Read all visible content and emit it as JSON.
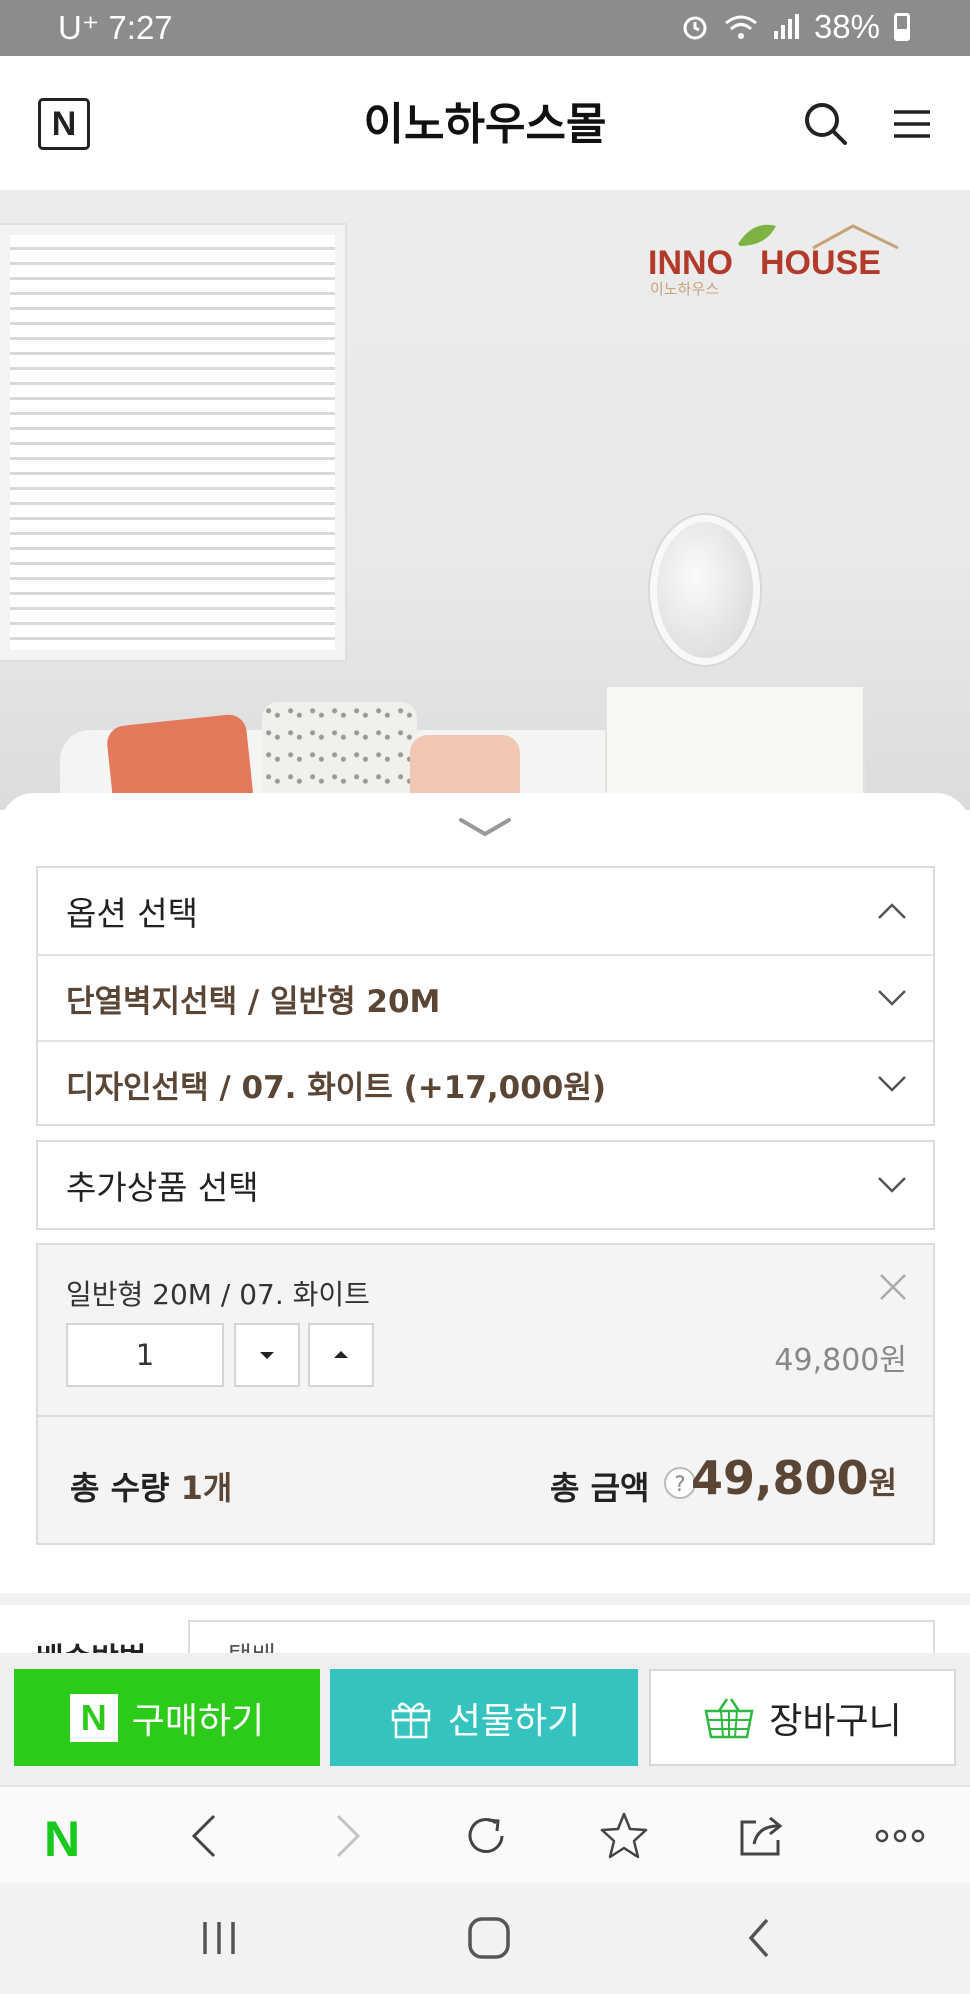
{
  "status_bar": {
    "carrier": "U⁺",
    "time": "7:27",
    "battery": "38%"
  },
  "header": {
    "logo": "N",
    "title": "이노하우스몰"
  },
  "hero": {
    "brand_en_1": "INNO",
    "brand_en_2": "HOUSE",
    "brand_kr": "이노하우스"
  },
  "options": {
    "header_label": "옵션 선택",
    "selected_1": "단열벽지선택 / 일반형 20M",
    "selected_2": "디자인선택 / 07. 화이트 (+17,000원)",
    "extra_label": "추가상품 선택"
  },
  "summary": {
    "item_name": "일반형 20M / 07. 화이트",
    "quantity": "1",
    "item_price": "49,800원",
    "total_qty_label": "총 수량",
    "total_qty_value": "1개",
    "total_amount_label": "총 금액",
    "help": "?",
    "total_amount": "49,800",
    "currency": "원"
  },
  "shipping": {
    "label": "배송방법",
    "value": "택배"
  },
  "actions": {
    "buy": "구매하기",
    "gift": "선물하기",
    "cart": "장바구니"
  },
  "colors": {
    "brand_green": "#2dcb19",
    "gift_teal": "#35c3c0",
    "accent_brown": "#5b4636"
  },
  "icons": [
    "search-icon",
    "menu-icon",
    "chevron-up-icon",
    "chevron-down-icon",
    "close-icon",
    "gift-icon",
    "basket-icon",
    "back-icon",
    "forward-icon",
    "refresh-icon",
    "star-icon",
    "share-icon",
    "more-icon"
  ]
}
